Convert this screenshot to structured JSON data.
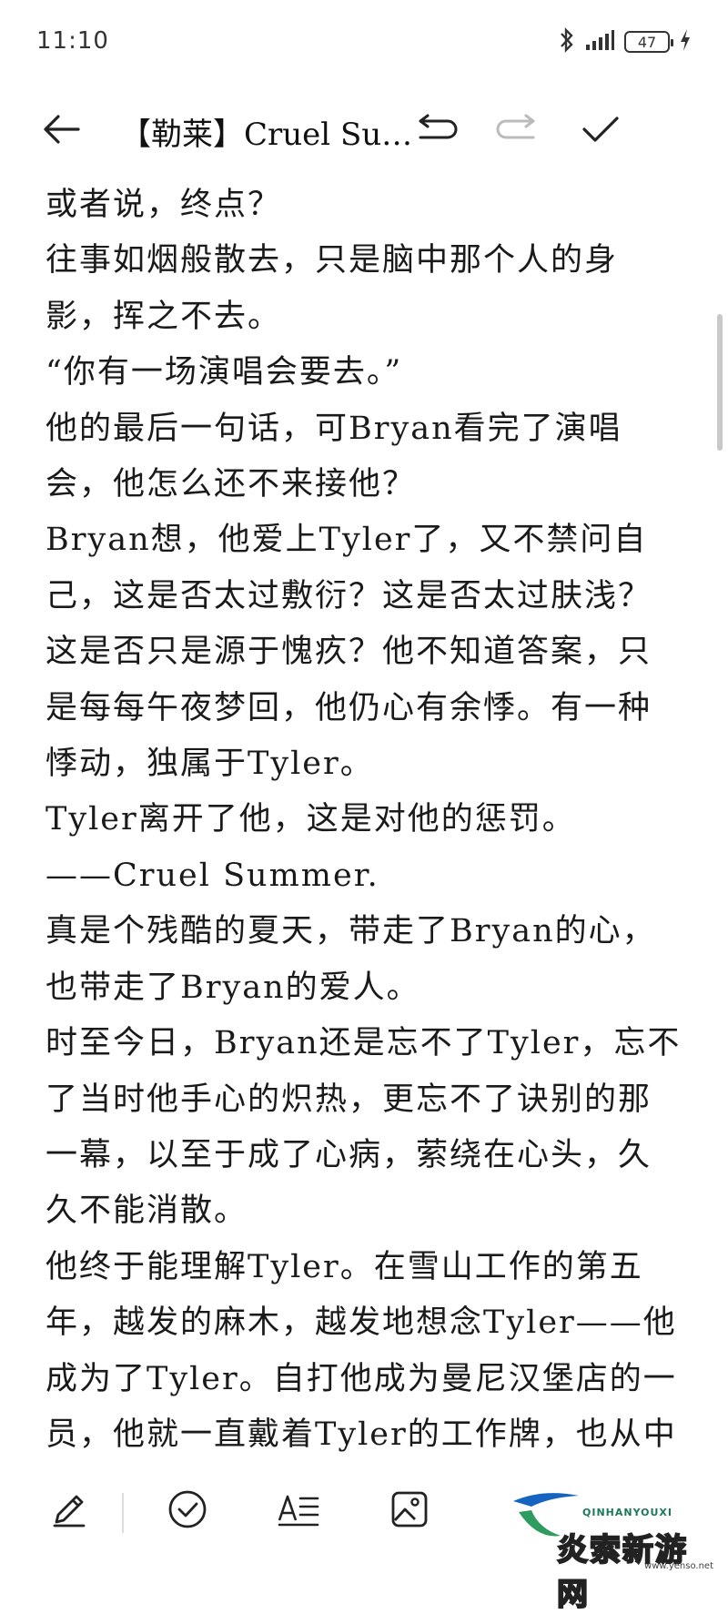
{
  "status_bar": {
    "time": "11:10",
    "battery": "47"
  },
  "toolbar": {
    "title": "【勒莱】Cruel Sum···"
  },
  "content": {
    "paragraphs": [
      "或者说，终点？",
      "往事如烟般散去，只是脑中那个人的身影，挥之不去。",
      "“你有一场演唱会要去。”",
      "他的最后一句话，可Bryan看完了演唱会，他怎么还不来接他？",
      "Bryan想，他爱上Tyler了，又不禁问自己，这是否太过敷衍？这是否太过肤浅？这是否只是源于愧疚？他不知道答案，只是每每午夜梦回，他仍心有余悸。有一种悸动，独属于Tyler。",
      "Tyler离开了他，这是对他的惩罚。",
      "——Cruel Summer.",
      "真是个残酷的夏天，带走了Bryan的心，也带走了Bryan的爱人。",
      "时至今日，Bryan还是忘不了Tyler，忘不了当时他手心的炽热，更忘不了诀别的那一幕，以至于成了心病，萦绕在心头，久久不能消散。",
      "他终于能理解Tyler。在雪山工作的第五年，越发的麻木，越发地想念Tyler——他成为了Tyler。自打他成为曼尼汉堡店的一员，他就一直戴着Tyler的工作牌，也从中"
    ]
  },
  "bottom_bar": {
    "icons": [
      "pen-icon",
      "check-circle-icon",
      "text-format-icon",
      "image-icon"
    ]
  },
  "watermark": {
    "brand": "QINHANYOUXI",
    "text": "炎索新游网",
    "url": "www.yenso.net"
  }
}
